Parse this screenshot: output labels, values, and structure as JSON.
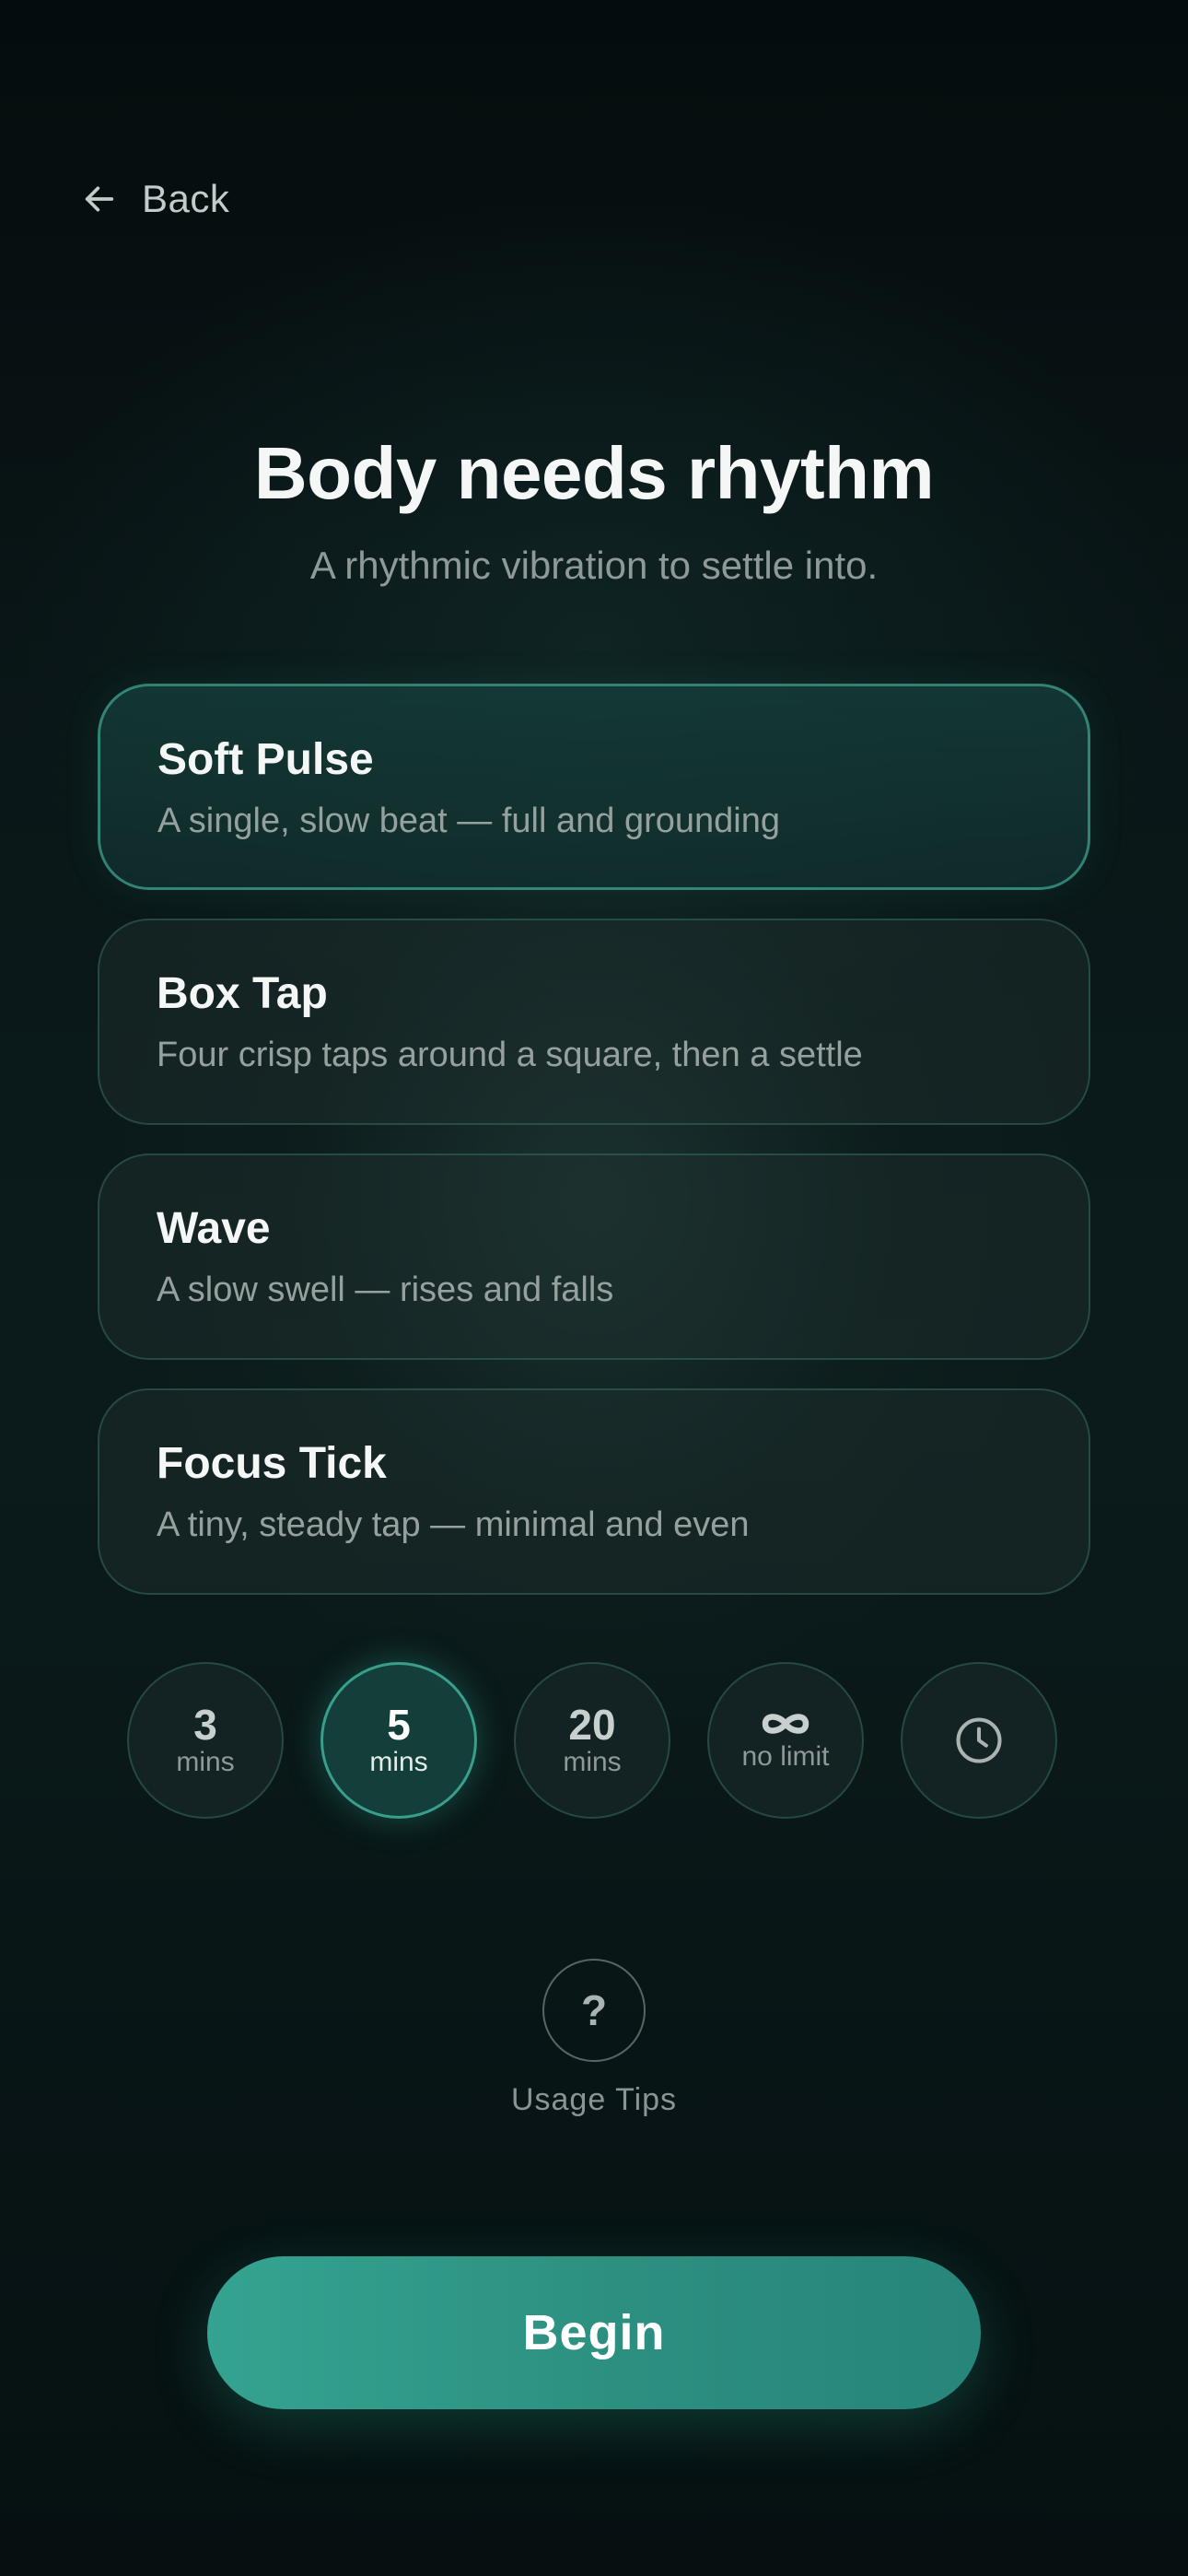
{
  "nav": {
    "back_label": "Back"
  },
  "header": {
    "title": "Body needs rhythm",
    "subtitle": "A rhythmic vibration to settle into."
  },
  "patterns": [
    {
      "name": "Soft Pulse",
      "description": "A single, slow beat — full and grounding",
      "selected": true
    },
    {
      "name": "Box Tap",
      "description": "Four crisp taps around a square, then a settle",
      "selected": false
    },
    {
      "name": "Wave",
      "description": "A slow swell — rises and falls",
      "selected": false
    },
    {
      "name": "Focus Tick",
      "description": "A tiny, steady tap — minimal and even",
      "selected": false
    }
  ],
  "durations": [
    {
      "value": "3",
      "unit": "mins",
      "selected": false
    },
    {
      "value": "5",
      "unit": "mins",
      "selected": true
    },
    {
      "value": "20",
      "unit": "mins",
      "selected": false
    },
    {
      "icon": "infinity-icon",
      "unit": "no limit",
      "selected": false
    },
    {
      "icon": "clock-icon",
      "selected": false
    }
  ],
  "tips": {
    "icon": "question-mark-icon",
    "glyph": "?",
    "label": "Usage Tips"
  },
  "cta": {
    "label": "Begin"
  },
  "colors": {
    "accent": "#35a391",
    "background": "#0a1718",
    "selected_border": "#3ea08c"
  }
}
